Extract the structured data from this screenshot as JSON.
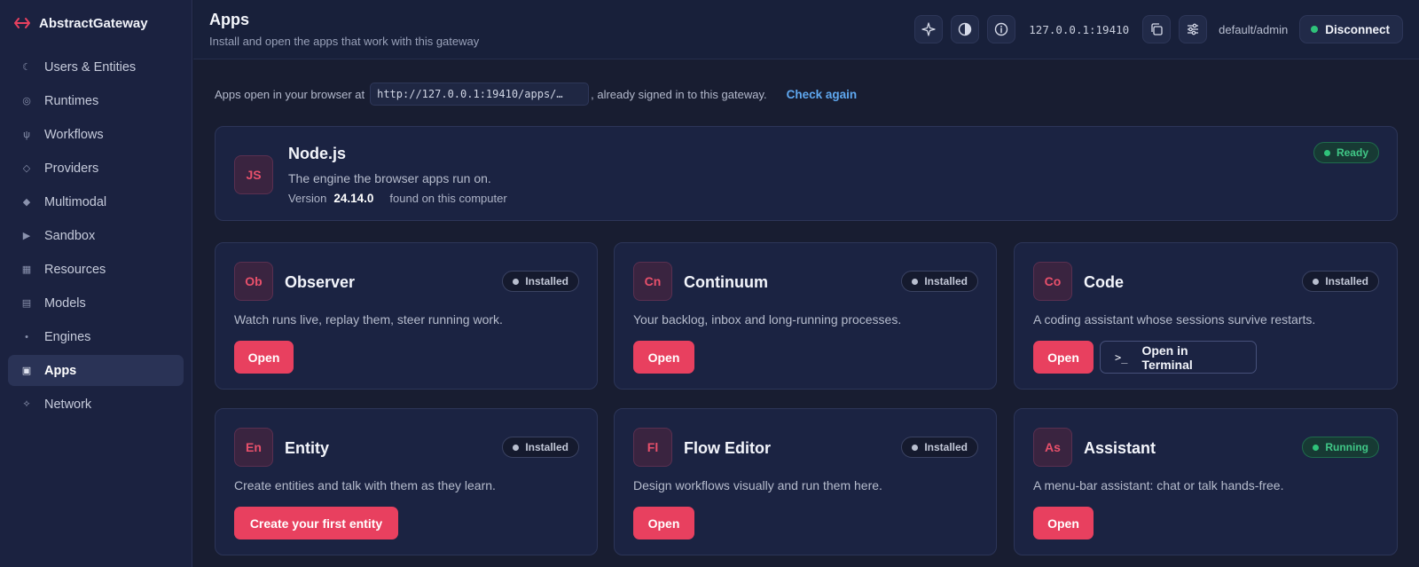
{
  "brand": {
    "name": "AbstractGateway"
  },
  "sidebar": {
    "items": [
      {
        "label": "Users & Entities",
        "icon": "moon-icon"
      },
      {
        "label": "Runtimes",
        "icon": "ring-icon"
      },
      {
        "label": "Workflows",
        "icon": "fork-icon"
      },
      {
        "label": "Providers",
        "icon": "diamond-outline-icon"
      },
      {
        "label": "Multimodal",
        "icon": "diamond-icon"
      },
      {
        "label": "Sandbox",
        "icon": "play-icon"
      },
      {
        "label": "Resources",
        "icon": "grid-icon"
      },
      {
        "label": "Models",
        "icon": "list-icon"
      },
      {
        "label": "Engines",
        "icon": "dot-icon"
      },
      {
        "label": "Apps",
        "icon": "square-icon",
        "active": true
      },
      {
        "label": "Network",
        "icon": "network-icon"
      }
    ]
  },
  "header": {
    "title": "Apps",
    "subtitle": "Install and open the apps that work with this gateway",
    "address": "127.0.0.1:19410",
    "account": "default/admin",
    "disconnect_label": "Disconnect"
  },
  "info": {
    "prefix": "Apps open in your browser at",
    "url": "http://127.0.0.1:19410/apps/…",
    "suffix": ", already signed in to this gateway.",
    "check_again": "Check again"
  },
  "node": {
    "initials": "JS",
    "title": "Node.js",
    "desc": "The engine the browser apps run on.",
    "version_label": "Version",
    "version": "24.14.0",
    "found": "found on this computer",
    "status": "Ready"
  },
  "apps": [
    {
      "initials": "Ob",
      "title": "Observer",
      "desc": "Watch runs live, replay them, steer running work.",
      "status": "Installed",
      "primary": "Open"
    },
    {
      "initials": "Cn",
      "title": "Continuum",
      "desc": "Your backlog, inbox and long-running processes.",
      "status": "Installed",
      "primary": "Open"
    },
    {
      "initials": "Co",
      "title": "Code",
      "desc": "A coding assistant whose sessions survive restarts.",
      "status": "Installed",
      "primary": "Open",
      "secondary": "Open in Terminal",
      "secondary_glyph": ">_"
    },
    {
      "initials": "En",
      "title": "Entity",
      "desc": "Create entities and talk with them as they learn.",
      "status": "Installed",
      "primary": "Create your first entity"
    },
    {
      "initials": "Fl",
      "title": "Flow Editor",
      "desc": "Design workflows visually and run them here.",
      "status": "Installed",
      "primary": "Open"
    },
    {
      "initials": "As",
      "title": "Assistant",
      "desc": "A menu-bar assistant: chat or talk hands-free.",
      "status": "Running",
      "primary": "Open"
    }
  ]
}
